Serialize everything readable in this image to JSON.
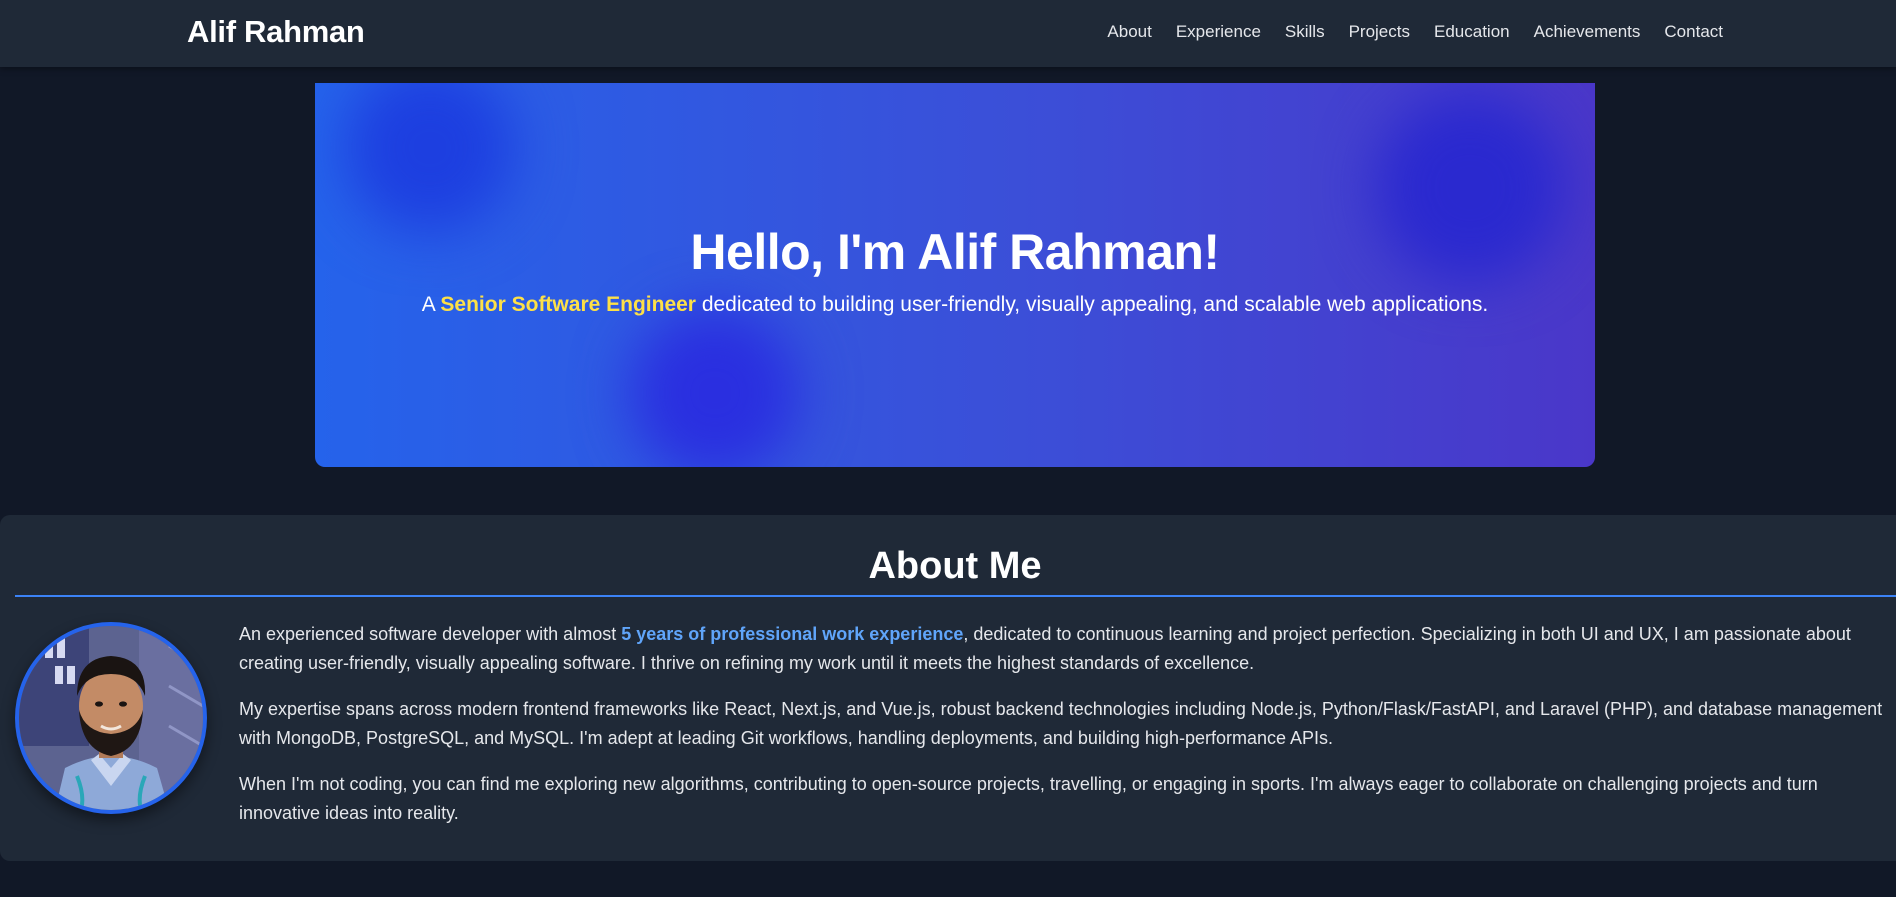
{
  "header": {
    "brand": "Alif Rahman",
    "nav": [
      {
        "label": "About"
      },
      {
        "label": "Experience"
      },
      {
        "label": "Skills"
      },
      {
        "label": "Projects"
      },
      {
        "label": "Education"
      },
      {
        "label": "Achievements"
      },
      {
        "label": "Contact"
      }
    ]
  },
  "hero": {
    "title": "Hello, I'm Alif Rahman!",
    "subtitle_prefix": "A ",
    "subtitle_highlight": "Senior Software Engineer",
    "subtitle_suffix": " dedicated to building user-friendly, visually appealing, and scalable web applications."
  },
  "about": {
    "title": "About Me",
    "avatar_alt": "Alif Rahman profile photo",
    "p1_prefix": "An experienced software developer with almost ",
    "p1_highlight": "5 years of professional work experience",
    "p1_suffix": ", dedicated to continuous learning and project perfection. Specializing in both UI and UX, I am passionate about creating user-friendly, visually appealing software. I thrive on refining my work until it meets the highest standards of excellence.",
    "p2": "My expertise spans across modern frontend frameworks like React, Next.js, and Vue.js, robust backend technologies including Node.js, Python/Flask/FastAPI, and Laravel (PHP), and database management with MongoDB, PostgreSQL, and MySQL. I'm adept at leading Git workflows, handling deployments, and building high-performance APIs.",
    "p3": "When I'm not coding, you can find me exploring new algorithms, contributing to open-source projects, travelling, or engaging in sports. I'm always eager to collaborate on challenging projects and turn innovative ideas into reality."
  },
  "colors": {
    "page_bg": "#111827",
    "header_bg": "#1f2937",
    "accent_blue": "#3b82f6",
    "highlight_yellow": "#fde047",
    "highlight_blue": "#60a5fa"
  }
}
